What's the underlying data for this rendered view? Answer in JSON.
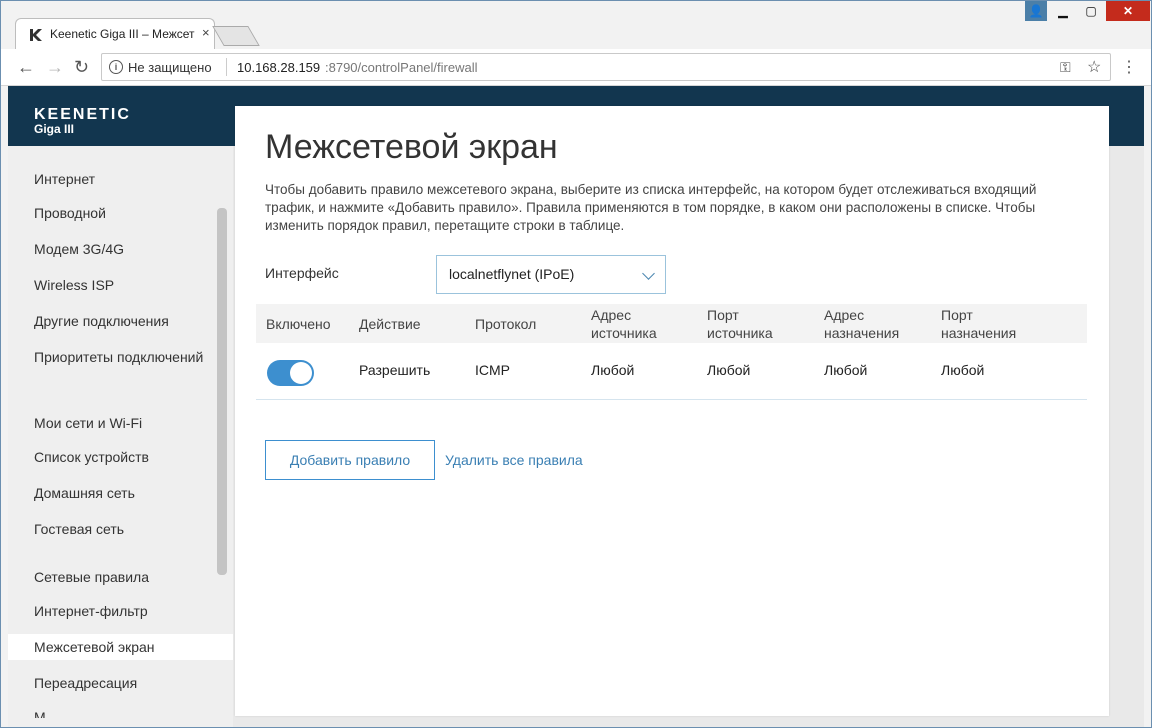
{
  "browser": {
    "tab_title": "Keenetic Giga III – Межсет",
    "tab_close": "×",
    "window_buttons": {
      "user": "👤",
      "minimize": "▁",
      "maximize": "▢",
      "close": "✕"
    },
    "nav": {
      "back": "←",
      "forward": "→",
      "reload": "↻",
      "menu": "⋮"
    },
    "address": {
      "info": "i",
      "security": "Не защищено",
      "host": "10.168.28.159",
      "rest": ":8790/controlPanel/firewall",
      "key_icon": "⚿",
      "star_icon": "☆"
    }
  },
  "header": {
    "logo": "KEENETIC",
    "model": "Giga III"
  },
  "sidebar": {
    "items": [
      {
        "label": "Интернет"
      },
      {
        "label": "Проводной"
      },
      {
        "label": "Модем 3G/4G"
      },
      {
        "label": "Wireless ISP"
      },
      {
        "label": "Другие подключения"
      },
      {
        "label": "Приоритеты подключений"
      },
      {
        "label": "Мои сети и Wi-Fi"
      },
      {
        "label": "Список устройств"
      },
      {
        "label": "Домашняя сеть"
      },
      {
        "label": "Гостевая сеть"
      },
      {
        "label": "Сетевые правила"
      },
      {
        "label": "Интернет-фильтр"
      },
      {
        "label": "Межсетевой экран"
      },
      {
        "label": "Переадресация"
      },
      {
        "label": "М..."
      }
    ]
  },
  "main": {
    "title": "Межсетевой экран",
    "description": "Чтобы добавить правило межсетевого экрана, выберите из списка интерфейс, на котором будет отслеживаться входящий трафик, и нажмите «Добавить правило». Правила применяются в том порядке, в каком они расположены в списке. Чтобы изменить порядок правил, перетащите строки в таблице.",
    "interface_label": "Интерфейс",
    "interface_value": "localnetflynet (IPoE)",
    "table": {
      "headers": [
        "Включено",
        "Действие",
        "Протокол",
        "Адрес источника",
        "Порт источника",
        "Адрес назначения",
        "Порт назначения"
      ],
      "rows": [
        {
          "enabled": true,
          "action": "Разрешить",
          "protocol": "ICMP",
          "src_addr": "Любой",
          "src_port": "Любой",
          "dst_addr": "Любой",
          "dst_port": "Любой"
        }
      ]
    },
    "add_button": "Добавить правило",
    "delete_all_link": "Удалить все правила"
  }
}
